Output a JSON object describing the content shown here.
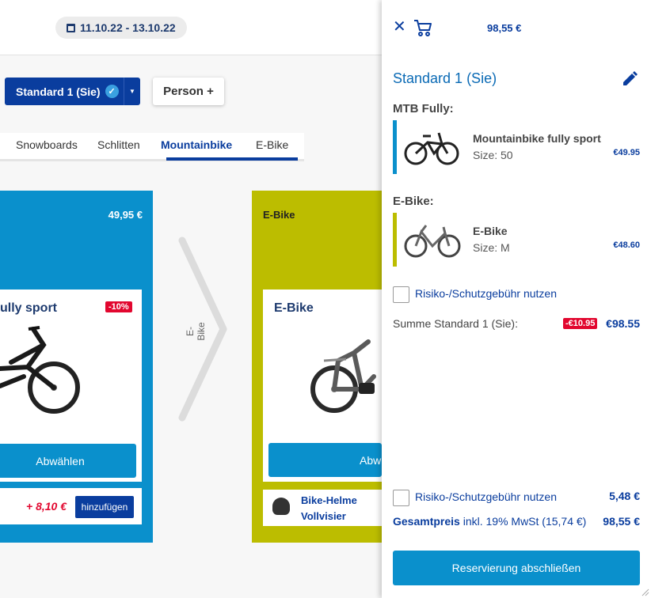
{
  "header": {
    "date_range": "11.10.22 - 13.10.22"
  },
  "toolbar": {
    "standard_label": "Standard 1 (Sie)",
    "person_label": "Person +"
  },
  "tabs": [
    {
      "label": "Snowboards"
    },
    {
      "label": "Schlitten"
    },
    {
      "label": "Mountainbike",
      "active": true
    },
    {
      "label": "E-Bike"
    }
  ],
  "cards": {
    "card1": {
      "price": "49,95 €",
      "product_title": "ully sport",
      "discount": "-10%",
      "button": "Abwählen",
      "addon_price": "+ 8,10 €",
      "addon_button": "hinzufügen"
    },
    "separator_label": "E-Bike",
    "card2": {
      "head": "E-Bike",
      "product_title": "E-Bike",
      "button": "Abw",
      "addon_line1": "Bike-Helme",
      "addon_line2": "Vollvisier"
    }
  },
  "panel": {
    "close_icon": "close-icon",
    "cart_icon": "cart-icon",
    "total_top": "98,55 €",
    "title": "Standard 1 (Sie)",
    "sections": [
      {
        "category": "MTB Fully:",
        "name": "Mountainbike fully sport",
        "size": "Size: 50",
        "price": "€49.95",
        "color": "#0a90cc"
      },
      {
        "category": "E-Bike:",
        "name": "E-Bike",
        "size": "Size: M",
        "price": "€48.60",
        "color": "#bcbd00"
      }
    ],
    "risk_label": "Risiko-/Schutzgebühr nutzen",
    "sum_label": "Summe Standard 1 (Sie):",
    "sum_discount": "-€10.95",
    "sum_value": "€98.55",
    "fee_label": "Risiko-/Schutzgebühr nutzen",
    "fee_value": "5,48 €",
    "total_label": "Gesamtpreis",
    "total_note": " inkl. 19% MwSt (15,74 €)",
    "total_value": "98,55 €",
    "reserve_button": "Reservierung abschließen"
  },
  "colors": {
    "primary": "#0a3d9e",
    "accent": "#0a90cc",
    "ebike": "#bcbd00",
    "danger": "#e2072f"
  }
}
